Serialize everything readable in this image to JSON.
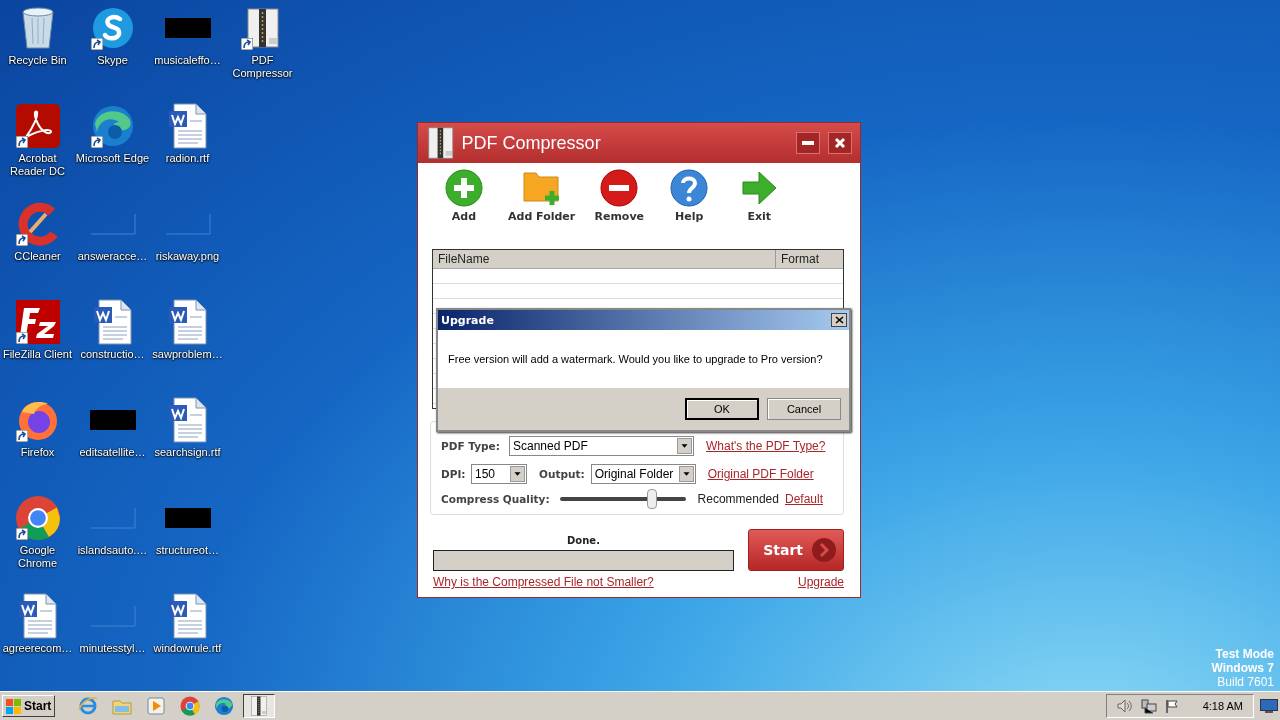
{
  "desktop": {
    "icons": [
      {
        "label": "Recycle Bin",
        "kind": "recycle-bin",
        "shortcut": false
      },
      {
        "label": "Acrobat Reader DC",
        "kind": "acrobat",
        "shortcut": true
      },
      {
        "label": "CCleaner",
        "kind": "ccleaner",
        "shortcut": true
      },
      {
        "label": "FileZilla Client",
        "kind": "filezilla",
        "shortcut": true
      },
      {
        "label": "Firefox",
        "kind": "firefox",
        "shortcut": true
      },
      {
        "label": "Google Chrome",
        "kind": "chrome",
        "shortcut": true
      },
      {
        "label": "agreerecom…",
        "kind": "document",
        "shortcut": false
      },
      {
        "label": "Skype",
        "kind": "skype",
        "shortcut": true
      },
      {
        "label": "Microsoft Edge",
        "kind": "edge",
        "shortcut": true
      },
      {
        "label": "answeracce…",
        "kind": "blank",
        "shortcut": false
      },
      {
        "label": "constructio…",
        "kind": "document",
        "shortcut": false
      },
      {
        "label": "editsatellite…",
        "kind": "redacted",
        "shortcut": false
      },
      {
        "label": "islandsauto.…",
        "kind": "blank",
        "shortcut": false
      },
      {
        "label": "minutesstyl…",
        "kind": "blank",
        "shortcut": false
      },
      {
        "label": "musicaleffo…",
        "kind": "redacted",
        "shortcut": false
      },
      {
        "label": "radion.rtf",
        "kind": "document",
        "shortcut": false
      },
      {
        "label": "riskaway.png",
        "kind": "blank",
        "shortcut": false
      },
      {
        "label": "sawproblem…",
        "kind": "document",
        "shortcut": false
      },
      {
        "label": "searchsign.rtf",
        "kind": "document",
        "shortcut": false
      },
      {
        "label": "structureot…",
        "kind": "redacted",
        "shortcut": false
      },
      {
        "label": "windowrule.rtf",
        "kind": "document",
        "shortcut": false
      },
      {
        "label": "PDF Compressor",
        "kind": "pdf-compressor",
        "shortcut": true
      }
    ]
  },
  "window": {
    "title": "PDF Compressor",
    "toolbar": [
      {
        "label": "Add",
        "kind": "add"
      },
      {
        "label": "Add Folder",
        "kind": "folder"
      },
      {
        "label": "Remove",
        "kind": "remove"
      },
      {
        "label": "Help",
        "kind": "help"
      },
      {
        "label": "Exit",
        "kind": "exit"
      }
    ],
    "table": {
      "columns": [
        "FileName",
        "Format"
      ]
    },
    "settings": {
      "pdf_type": {
        "label": "PDF Type:",
        "value": "Scanned PDF",
        "link": "What's the PDF Type?"
      },
      "dpi": {
        "label": "DPI:",
        "value": "150"
      },
      "output": {
        "label": "Output:",
        "value": "Original Folder",
        "link": "Original PDF Folder"
      },
      "quality": {
        "label": "Compress Quality:",
        "level": 0.73,
        "reading": "Recommended",
        "link": "Default"
      }
    },
    "status": "Done.",
    "progress": {
      "level": 1
    },
    "start": "Start",
    "help_link": "Why is the Compressed File not Smaller?",
    "upgrade_link": "Upgrade"
  },
  "dialog": {
    "title": "Upgrade",
    "message": "Free version will add a watermark. Would you like to upgrade to Pro version?",
    "buttons": [
      {
        "label": "OK",
        "default": true
      },
      {
        "label": "Cancel",
        "default": false
      }
    ]
  },
  "system_info": [
    "Test Mode",
    "Windows 7",
    "Build 7601"
  ],
  "taskbar": {
    "start": "Start",
    "quick_launch": [
      {
        "kind": "ie"
      },
      {
        "kind": "explorer"
      },
      {
        "kind": "media"
      },
      {
        "kind": "chrome"
      },
      {
        "kind": "edge"
      }
    ],
    "tasks": [
      {
        "kind": "pdf-compressor",
        "active": true
      }
    ],
    "clock": "4:18 AM"
  }
}
